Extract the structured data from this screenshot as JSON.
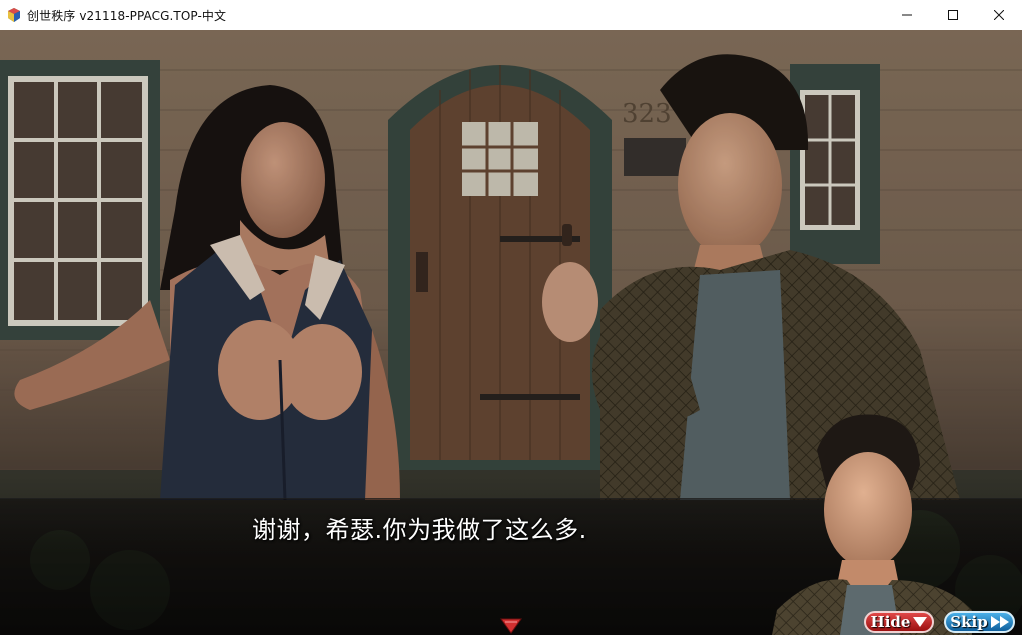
{
  "window": {
    "title": "创世秩序 v21118-PPACG.TOP-中文",
    "controls": [
      "minimize-icon",
      "maximize-icon",
      "close-icon"
    ]
  },
  "game": {
    "house_number": "323",
    "dialogue": {
      "text": "谢谢，希瑟.你为我做了这么多."
    },
    "quick_menu": {
      "hide_label": "Hide",
      "skip_label": "Skip"
    },
    "colors": {
      "hide_button": "#c42a2a",
      "skip_button": "#2b8fd0",
      "dialogue_text": "#ffffff",
      "continue_arrow": "#d23030"
    }
  }
}
